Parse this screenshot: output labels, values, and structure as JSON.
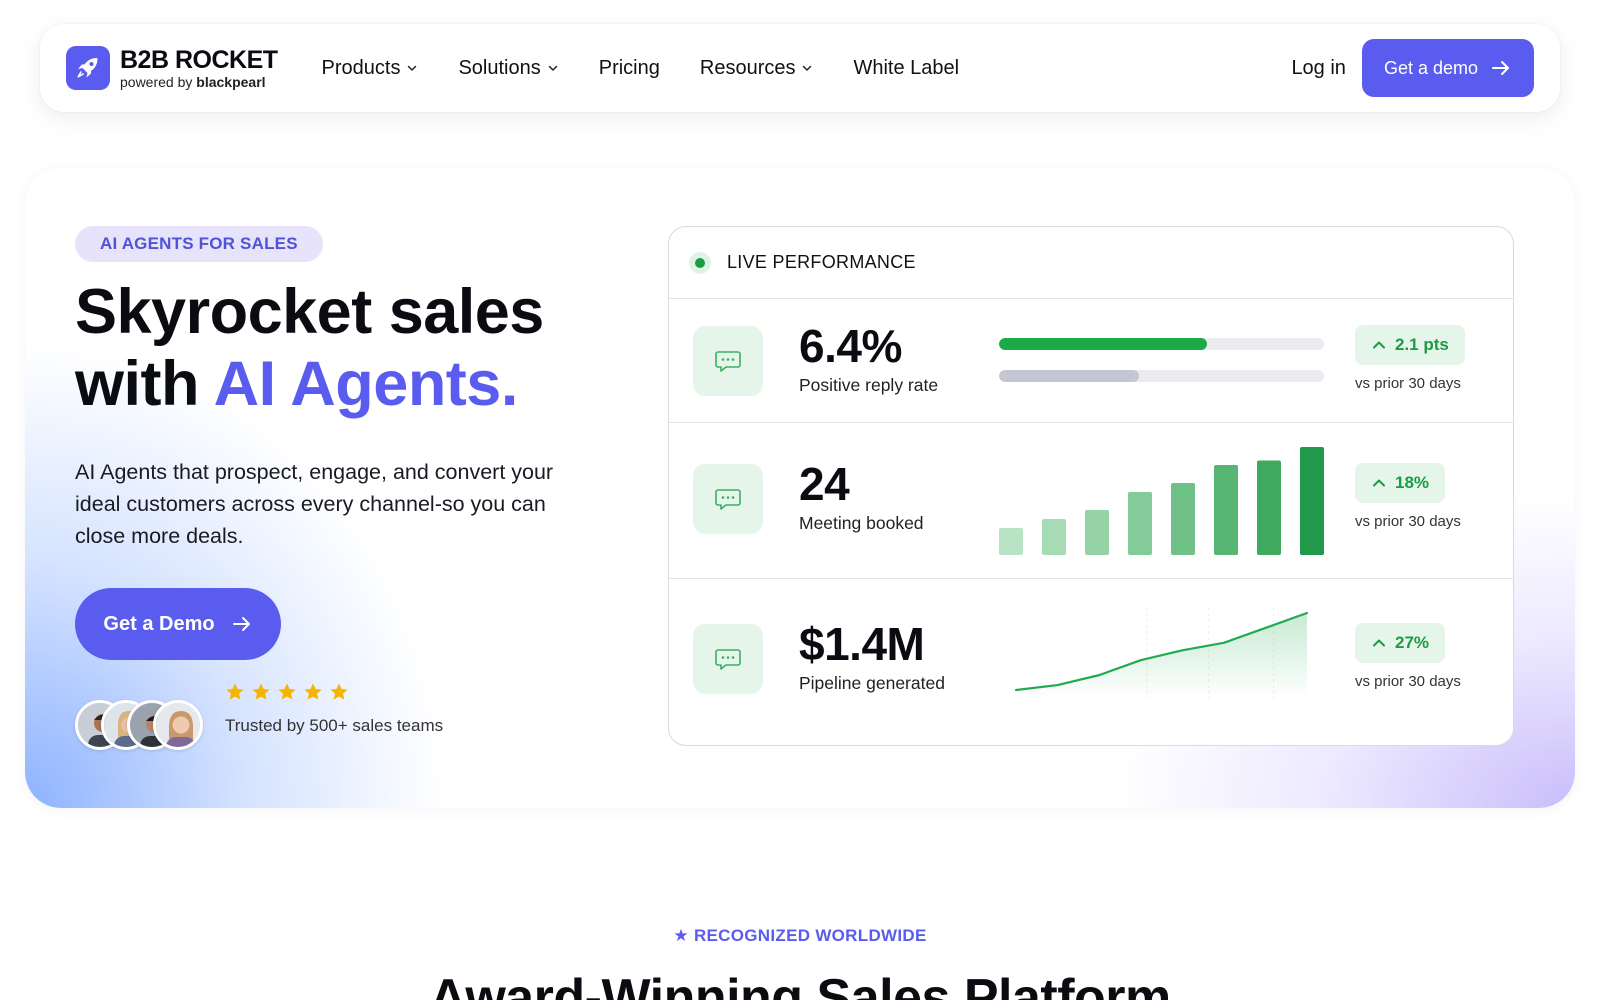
{
  "nav": {
    "logo_name": "B2B ROCKET",
    "logo_sub_prefix": "powered by ",
    "logo_sub_brand": "blackpearl",
    "items": [
      {
        "label": "Products",
        "dropdown": true
      },
      {
        "label": "Solutions",
        "dropdown": true
      },
      {
        "label": "Pricing",
        "dropdown": false
      },
      {
        "label": "Resources",
        "dropdown": true
      },
      {
        "label": "White Label",
        "dropdown": false
      }
    ],
    "login": "Log in",
    "demo": "Get a demo"
  },
  "hero": {
    "badge": "AI AGENTS FOR SALES",
    "headline_line1": "Skyrocket sales",
    "headline_with": "with ",
    "headline_accent": "AI Agents.",
    "subtext": "AI Agents that prospect, engage, and convert your ideal customers across every channel-so you can close more deals.",
    "cta": "Get a Demo",
    "rating_stars": 5,
    "trusted": "Trusted by 500+ sales teams"
  },
  "performance": {
    "title": "LIVE PERFORMANCE",
    "metrics": [
      {
        "value": "6.4%",
        "label": "Positive reply rate",
        "delta": "2.1 pts",
        "prior": "vs prior 30 days",
        "current_fraction": 0.64,
        "prior_fraction": 0.43
      },
      {
        "value": "24",
        "label": "Meeting booked",
        "delta": "18%",
        "prior": "vs prior 30 days",
        "bars": [
          3,
          4,
          5,
          7,
          8,
          10,
          10.5,
          12
        ]
      },
      {
        "value": "$1.4M",
        "label": "Pipeline generated",
        "delta": "27%",
        "prior": "vs prior 30 days",
        "trend": [
          2,
          4,
          8,
          14,
          18,
          21,
          27,
          33
        ]
      }
    ]
  },
  "colors": {
    "brand": "#5a5cf0",
    "positive": "#1a9c43",
    "star": "#f5b400"
  },
  "recognized": {
    "label": "RECOGNIZED WORLDWIDE",
    "heading": "Award-Winning Sales Platform"
  }
}
